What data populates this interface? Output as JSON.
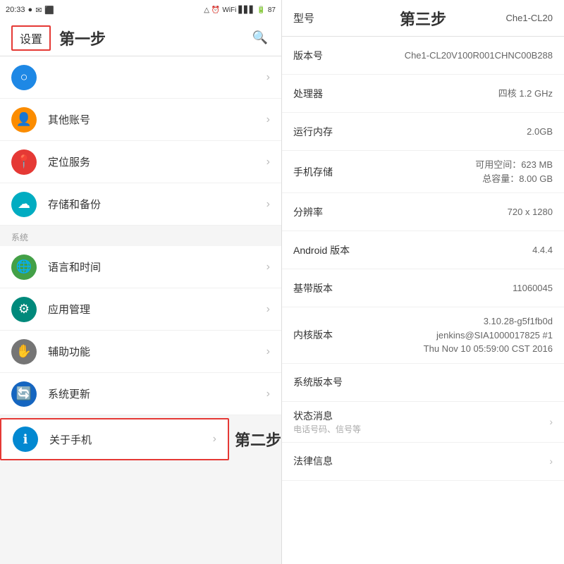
{
  "statusBar": {
    "time": "20:33",
    "battery": "87"
  },
  "leftPanel": {
    "settingsLabel": "设置",
    "stepOneLabel": "第一步",
    "sectionSystem": "系统",
    "menuItems": [
      {
        "id": "account",
        "label": "其他账号",
        "iconClass": "icon-orange",
        "iconSymbol": "👤"
      },
      {
        "id": "location",
        "label": "定位服务",
        "iconClass": "icon-red",
        "iconSymbol": "📍"
      },
      {
        "id": "storage",
        "label": "存储和备份",
        "iconClass": "icon-teal",
        "iconSymbol": "☁"
      },
      {
        "id": "language",
        "label": "语言和时间",
        "iconClass": "icon-green",
        "iconSymbol": "🌐"
      },
      {
        "id": "appmanage",
        "label": "应用管理",
        "iconClass": "icon-green2",
        "iconSymbol": "⚙"
      },
      {
        "id": "assist",
        "label": "辅助功能",
        "iconClass": "icon-gray",
        "iconSymbol": "✋"
      },
      {
        "id": "update",
        "label": "系统更新",
        "iconClass": "icon-blue2",
        "iconSymbol": "🔄"
      },
      {
        "id": "about",
        "label": "关于手机",
        "iconClass": "icon-info",
        "iconSymbol": "ℹ",
        "highlighted": true
      }
    ],
    "stepTwoLabel": "第二步"
  },
  "rightPanel": {
    "stepThreeLabel": "第三步",
    "rows": [
      {
        "id": "model",
        "label": "型号",
        "value": "Che1-CL20",
        "clickable": false
      },
      {
        "id": "version",
        "label": "版本号",
        "value": "Che1-CL20V100R001CHNC00B288",
        "clickable": false
      },
      {
        "id": "cpu",
        "label": "处理器",
        "value": "四核 1.2 GHz",
        "clickable": false
      },
      {
        "id": "ram",
        "label": "运行内存",
        "value": "2.0GB",
        "clickable": false
      },
      {
        "id": "storage",
        "label": "手机存储",
        "value": "可用空间：623 MB\n总容量：8.00 GB",
        "clickable": false
      },
      {
        "id": "resolution",
        "label": "分辨率",
        "value": "720 x 1280",
        "clickable": false
      },
      {
        "id": "android",
        "label": "Android 版本",
        "value": "4.4.4",
        "clickable": false
      },
      {
        "id": "baseband",
        "label": "基带版本",
        "value": "11060045",
        "clickable": false
      },
      {
        "id": "kernel",
        "label": "内核版本",
        "value": "3.10.28-g5f1fb0d\njenkins@SIA1000017825 #1\nThu Nov 10 05:59:00 CST 2016",
        "clickable": false
      },
      {
        "id": "sysbuild",
        "label": "系统版本号",
        "value": "",
        "clickable": false
      },
      {
        "id": "status",
        "label": "状态消息",
        "sublabel": "电话号码、信号等",
        "value": "",
        "clickable": true
      },
      {
        "id": "legal",
        "label": "法律信息",
        "value": "",
        "clickable": true
      }
    ]
  }
}
